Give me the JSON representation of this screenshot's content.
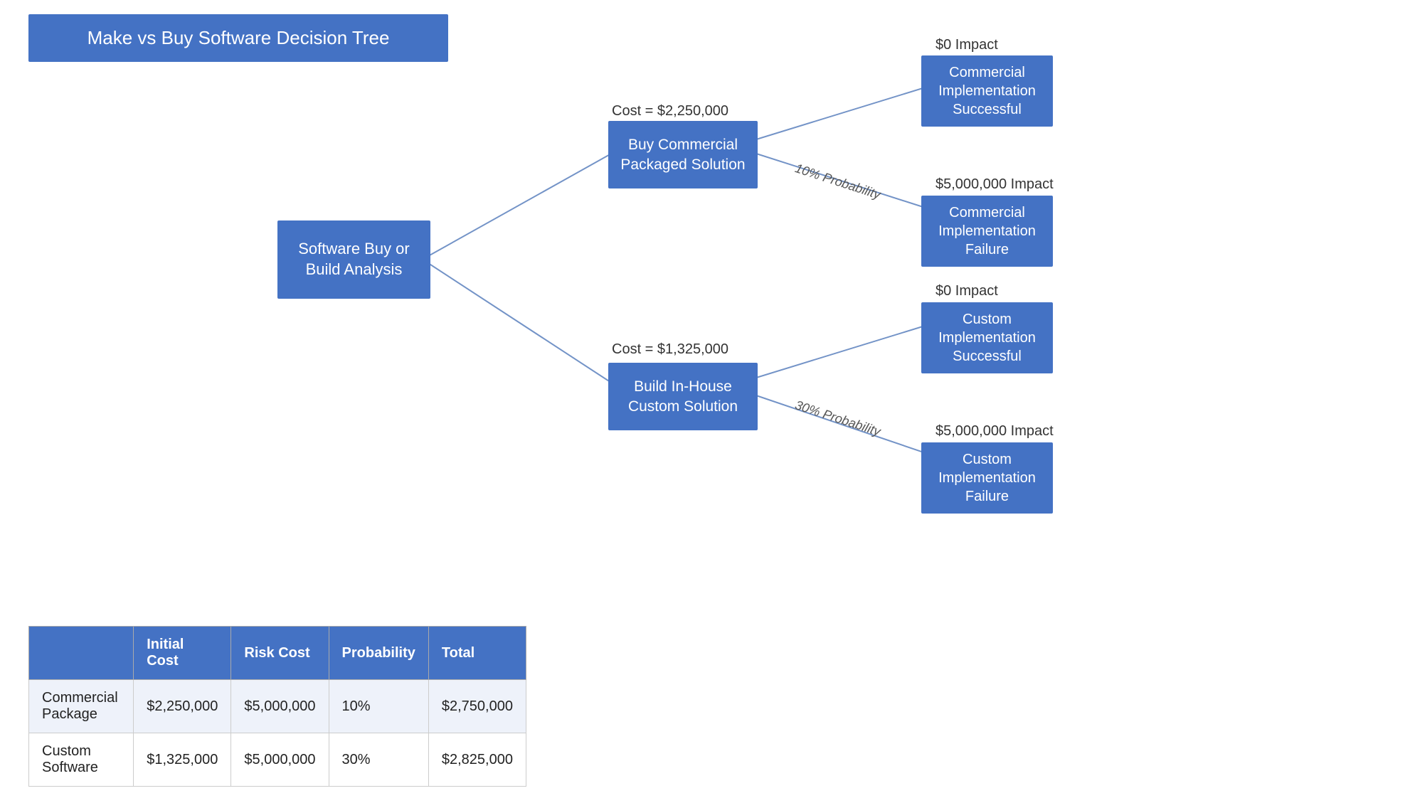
{
  "title": "Make vs Buy Software Decision Tree",
  "nodes": {
    "root": {
      "label": "Software Buy or\nBuild Analysis"
    },
    "buy": {
      "label": "Buy Commercial\nPackaged Solution"
    },
    "build": {
      "label": "Build In-House\nCustom Solution"
    },
    "comm_success": {
      "label": "Commercial\nImplementation\nSuccessful"
    },
    "comm_failure": {
      "label": "Commercial\nImplementation\nFailure"
    },
    "custom_success": {
      "label": "Custom\nImplementation\nSuccessful"
    },
    "custom_failure": {
      "label": "Custom\nImplementation\nFailure"
    }
  },
  "costs": {
    "buy": "Cost = $2,250,000",
    "build": "Cost = $1,325,000"
  },
  "probabilities": {
    "buy": "10% Probability",
    "build": "30% Probability"
  },
  "impacts": {
    "comm_success": "$0 Impact",
    "comm_failure": "$5,000,000 Impact",
    "custom_success": "$0 Impact",
    "custom_failure": "$5,000,000 Impact"
  },
  "table": {
    "headers": [
      "",
      "Initial Cost",
      "Risk Cost",
      "Probability",
      "Total"
    ],
    "rows": [
      [
        "Commercial Package",
        "$2,250,000",
        "$5,000,000",
        "10%",
        "$2,750,000"
      ],
      [
        "Custom Software",
        "$1,325,000",
        "$5,000,000",
        "30%",
        "$2,825,000"
      ]
    ]
  }
}
